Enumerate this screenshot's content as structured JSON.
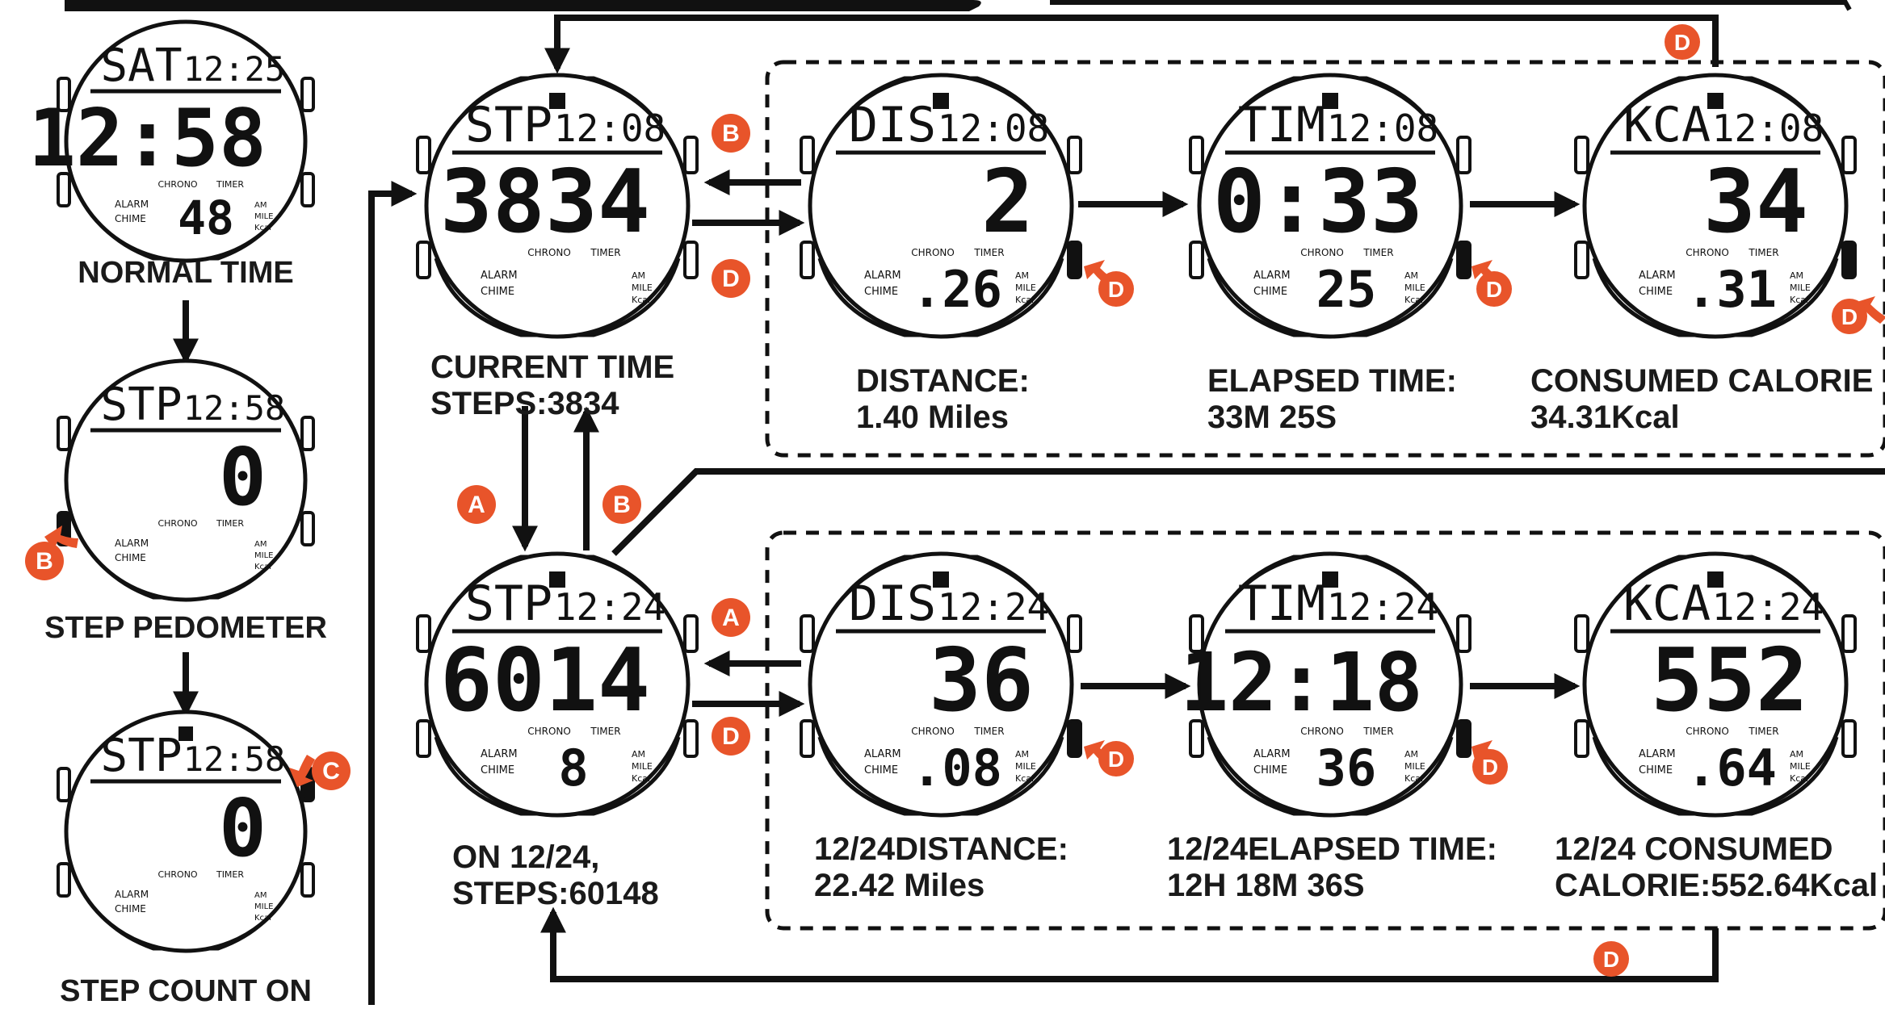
{
  "colors": {
    "badge": "#e8542a",
    "ink": "#111111",
    "paper": "#ffffff"
  },
  "watch_labels": {
    "chrono": "CHRONO",
    "timer": "TIMER",
    "alarm": "ALARM",
    "chime": "CHIME",
    "am": "AM",
    "mile": "MILE",
    "kcal": "Kcal"
  },
  "watches": [
    {
      "top_left": "SAT",
      "top_right": "12:25",
      "main": "12:58",
      "sub": "48"
    },
    {
      "top_left": "STP",
      "top_right": "12:58",
      "main": "0",
      "sub": ""
    },
    {
      "top_left": "STP",
      "top_right": "12:58",
      "main": "0",
      "sub": ""
    },
    {
      "top_left": "STP",
      "top_right": "12:08",
      "main": "3834",
      "sub": ""
    },
    {
      "top_left": "DIS",
      "top_right": "12:08",
      "main": "2",
      "sub": ".26"
    },
    {
      "top_left": "TIM",
      "top_right": "12:08",
      "main": "0:33",
      "sub": "25"
    },
    {
      "top_left": "KCA",
      "top_right": "12:08",
      "main": "34",
      "sub": ".31"
    },
    {
      "top_left": "STP",
      "top_right": "12:24",
      "main": "6014",
      "sub": "8"
    },
    {
      "top_left": "DIS",
      "top_right": "12:24",
      "main": "36",
      "sub": ".08"
    },
    {
      "top_left": "TIM",
      "top_right": "12:24",
      "main": "12:18",
      "sub": "36"
    },
    {
      "top_left": "KCA",
      "top_right": "12:24",
      "main": "552",
      "sub": ".64"
    }
  ],
  "captions": {
    "normal_time": "NORMAL TIME",
    "step_pedometer": "STEP PEDOMETER",
    "step_count_on": "STEP COUNT ON",
    "current_time_line1": "CURRENT TIME",
    "current_time_line2": "STEPS:3834",
    "distance_line1": "DISTANCE:",
    "distance_line2": "1.40 Miles",
    "elapsed_line1": "ELAPSED TIME:",
    "elapsed_line2": "33M 25S",
    "calorie_line1": "CONSUMED CALORIE",
    "calorie_line2": "34.31Kcal",
    "on1224_line1": "ON 12/24,",
    "on1224_line2": "STEPS:60148",
    "distance1224_line1": "12/24DISTANCE:",
    "distance1224_line2": "22.42 Miles",
    "elapsed1224_line1": "12/24ELAPSED TIME:",
    "elapsed1224_line2": "12H 18M 36S",
    "calorie1224_line1": "12/24 CONSUMED",
    "calorie1224_line2": "CALORIE:552.64Kcal"
  },
  "buttons": {
    "a": "A",
    "b": "B",
    "c": "C",
    "d": "D"
  }
}
